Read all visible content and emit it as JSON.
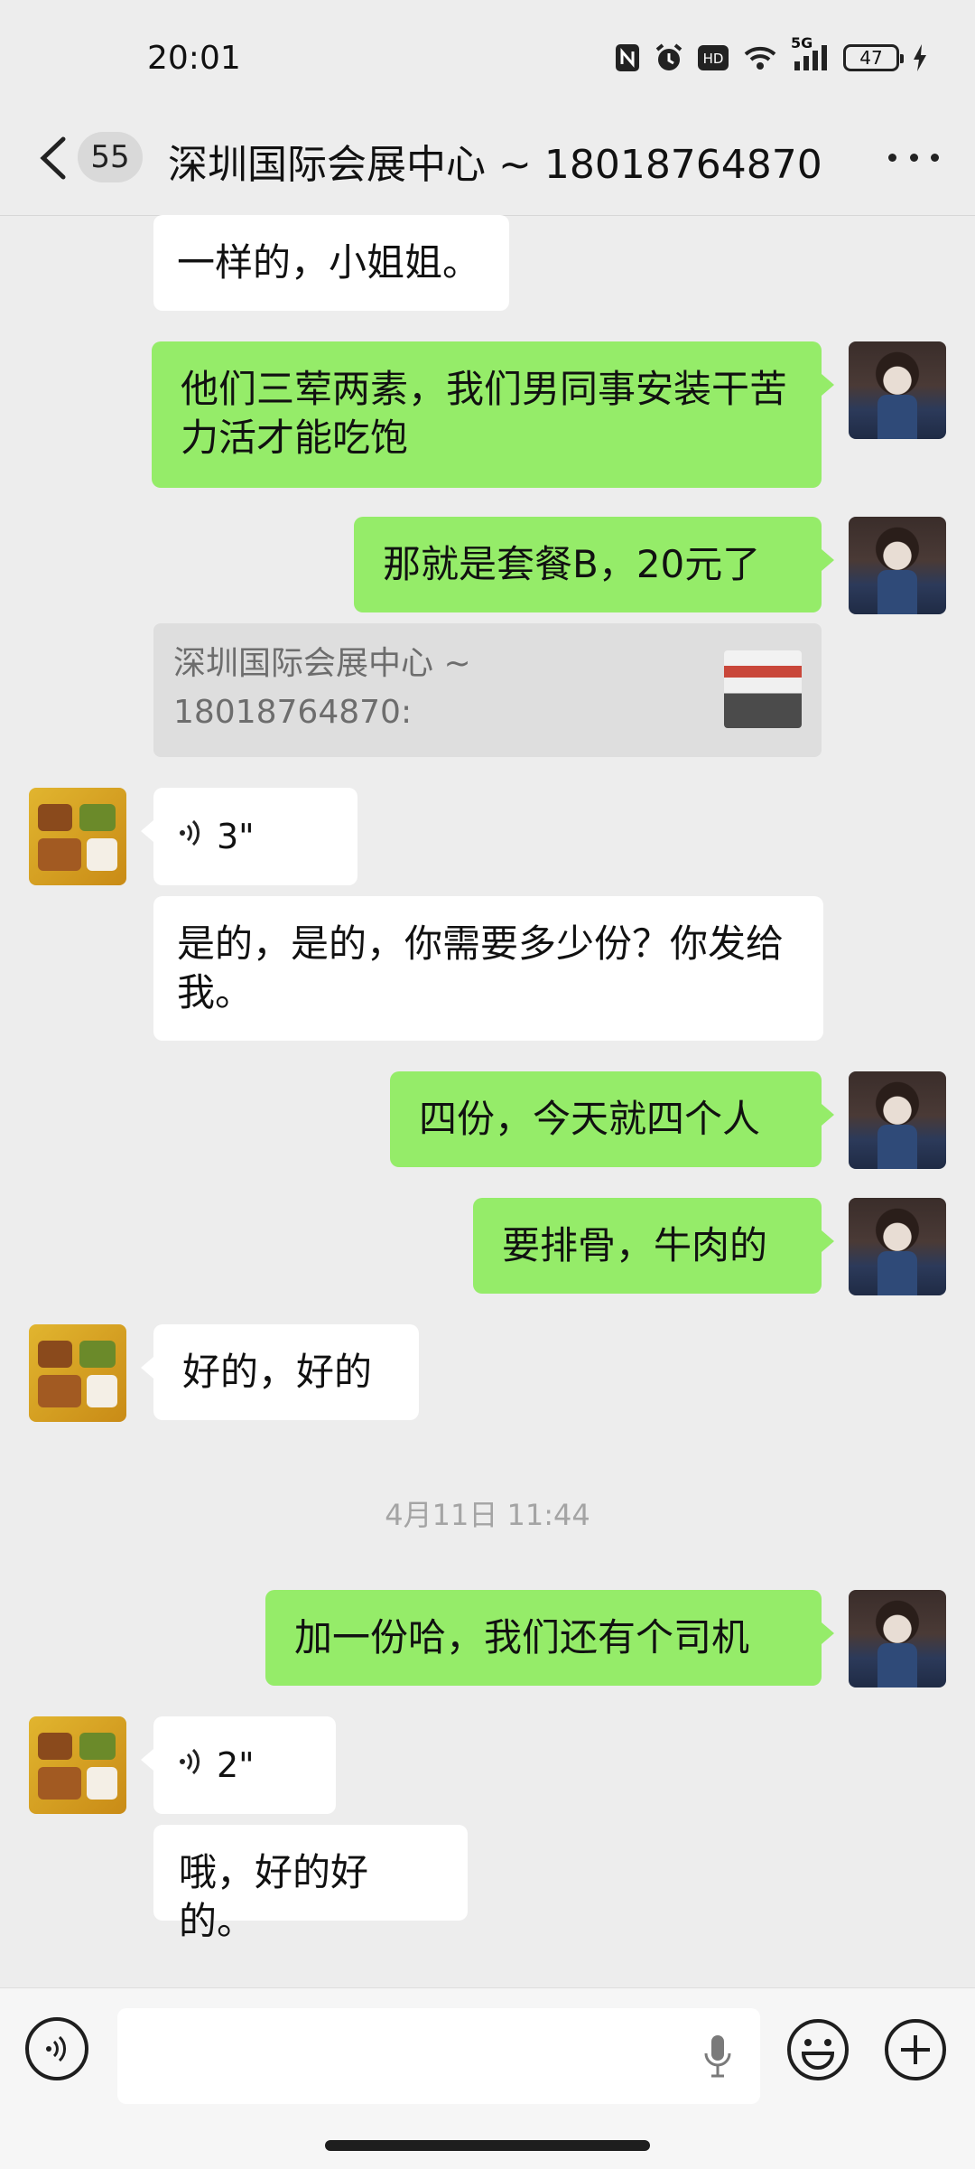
{
  "status": {
    "time": "20:01",
    "battery": "47",
    "network": "5G",
    "hd": "HD"
  },
  "header": {
    "unread": "55",
    "title": "深圳国际会展中心 ~ 18018764870"
  },
  "messages": [
    {
      "from": "contact",
      "text": "一样的，小姐姐。"
    },
    {
      "from": "me",
      "text": "他们三荤两素，我们男同事安装干苦力活才能吃饱"
    },
    {
      "from": "me",
      "text": "那就是套餐B，20元了"
    },
    {
      "from": "quote",
      "text": "深圳国际会展中心 ~ 18018764870:"
    },
    {
      "from": "contact",
      "type": "voice",
      "duration": "3\""
    },
    {
      "from": "contact",
      "text": "是的，是的，你需要多少份？你发给我。"
    },
    {
      "from": "me",
      "text": "四份，今天就四个人"
    },
    {
      "from": "me",
      "text": "要排骨，牛肉的"
    },
    {
      "from": "contact",
      "text": "好的，好的"
    },
    {
      "from": "me",
      "text": "加一份哈，我们还有个司机"
    },
    {
      "from": "contact",
      "type": "voice",
      "duration": "2\""
    },
    {
      "from": "contact",
      "text": "哦，好的好的。"
    }
  ],
  "timestamp": "4月11日 11:44",
  "colors": {
    "background": "#ededed",
    "outgoing_bubble": "#95ec69",
    "incoming_bubble": "#ffffff"
  }
}
